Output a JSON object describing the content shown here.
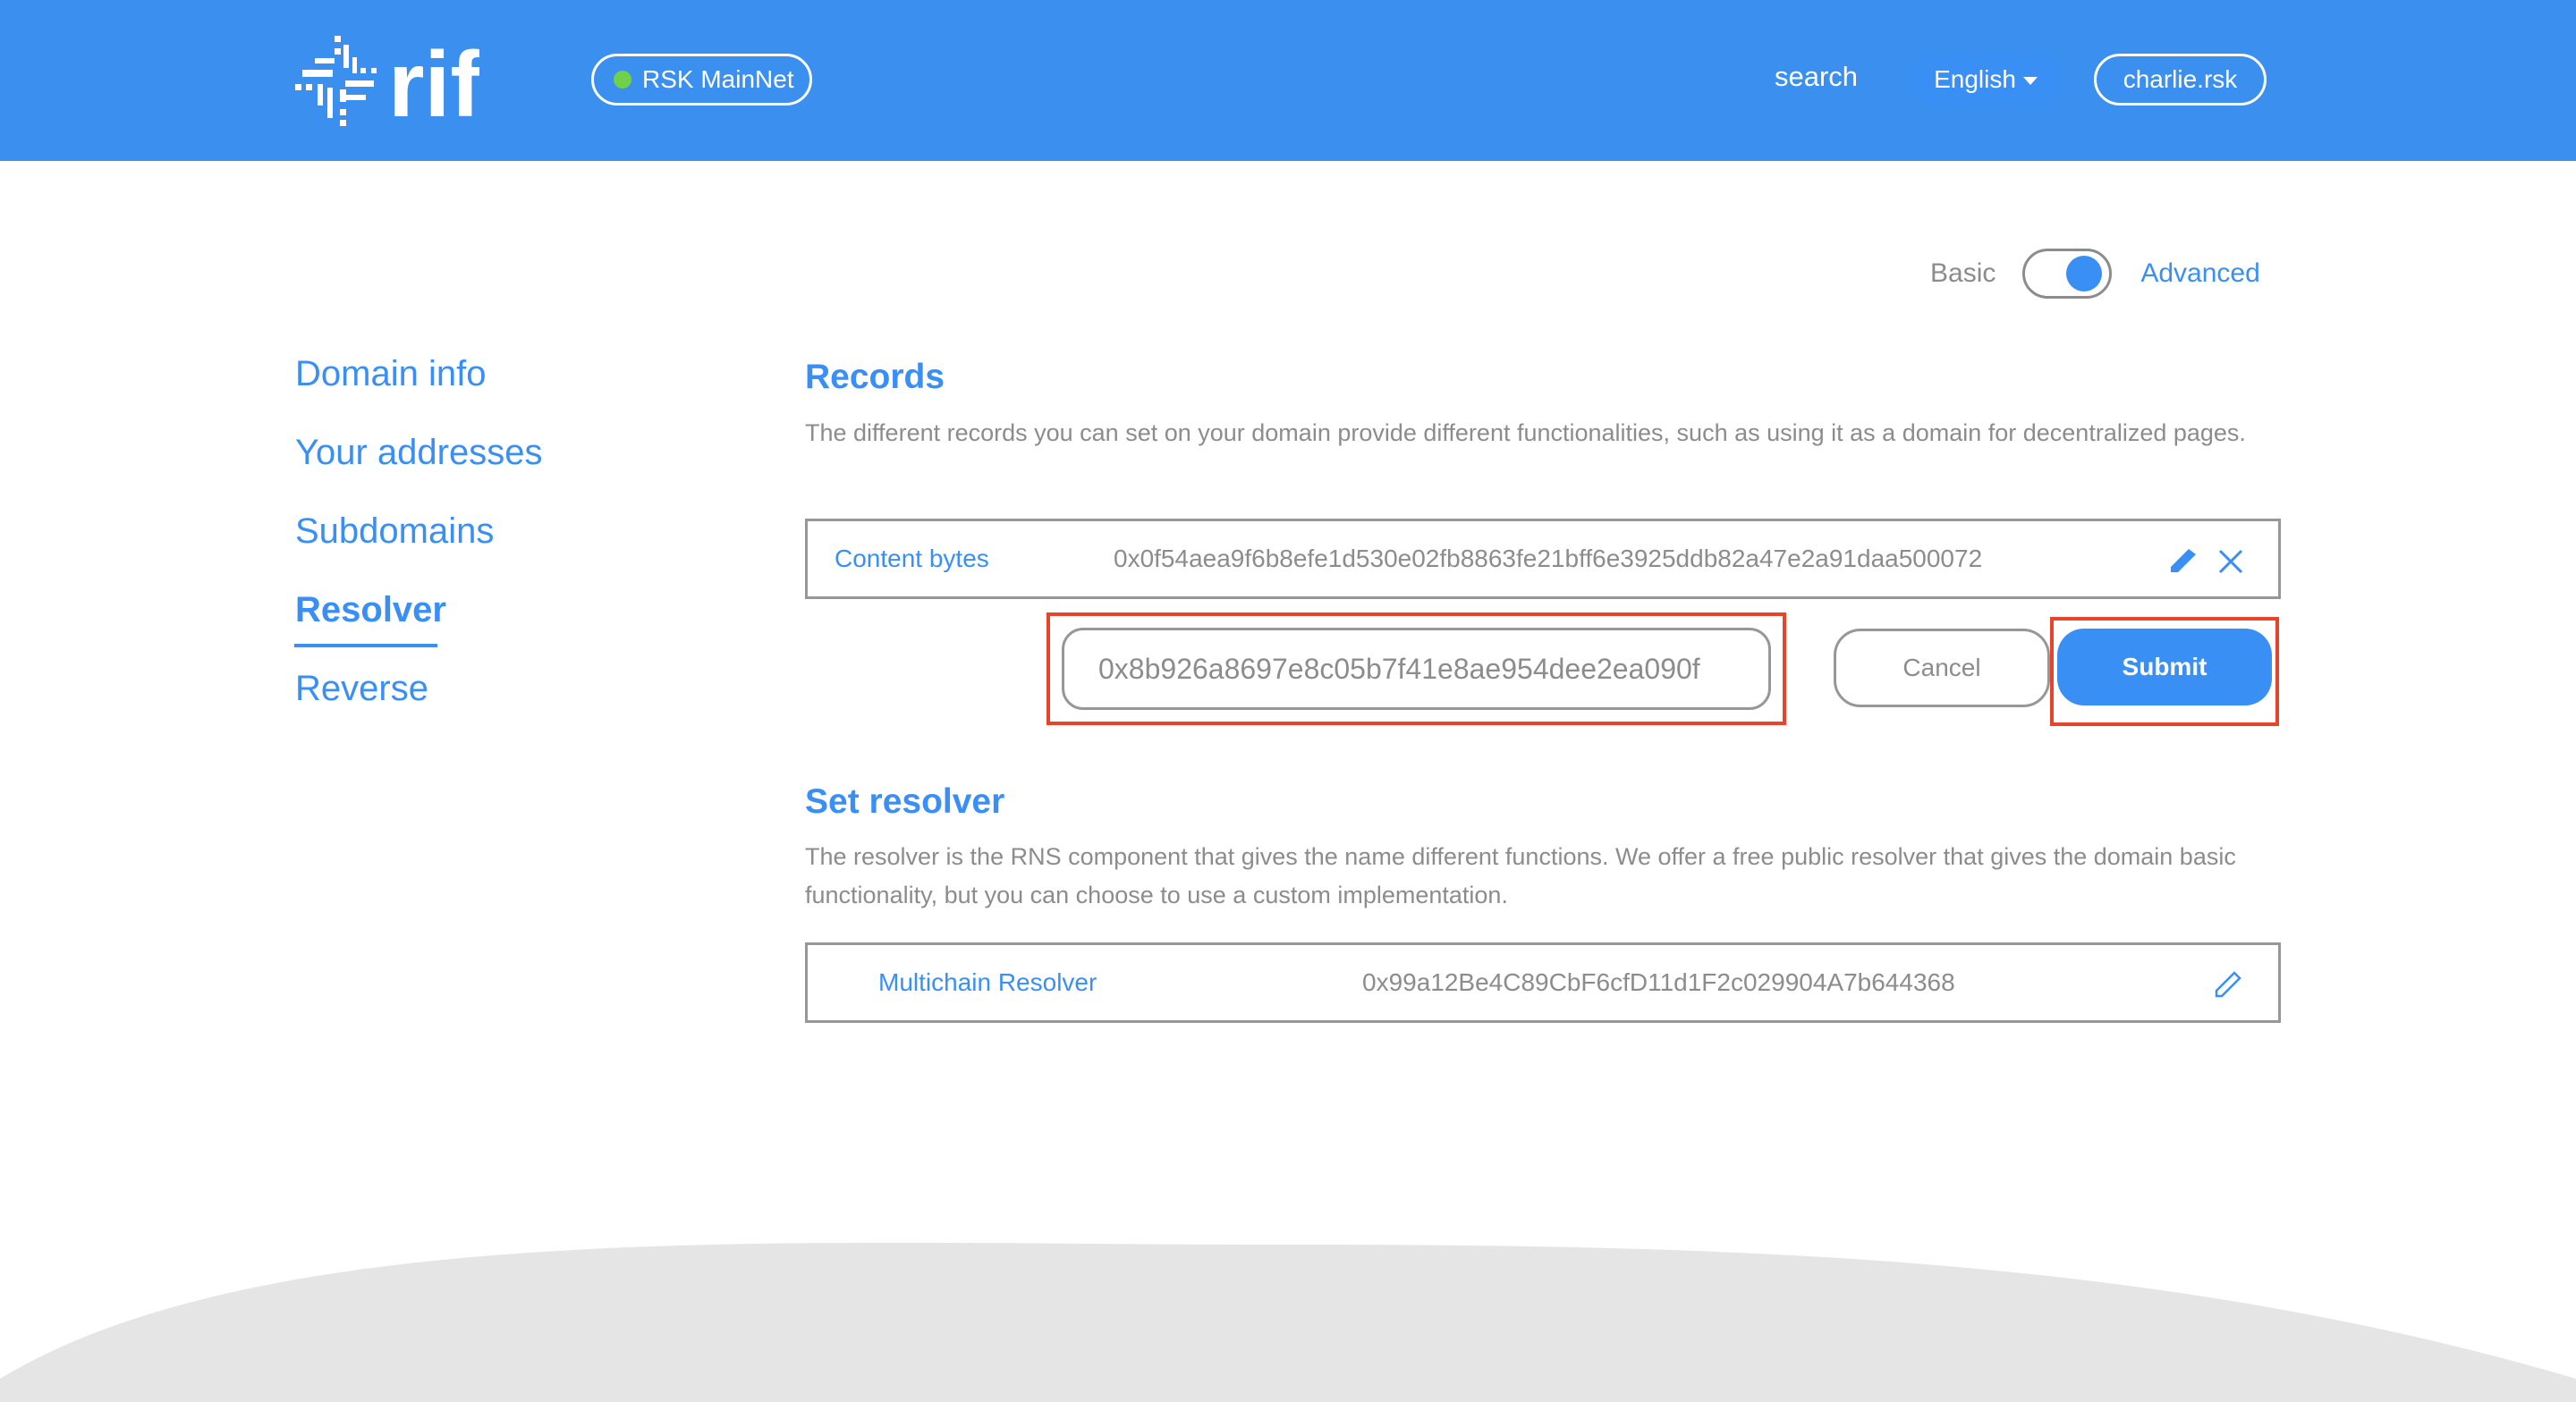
{
  "header": {
    "logo_text": "rif",
    "network": {
      "label": "RSK MainNet",
      "status_color": "#6fd147"
    },
    "search_label": "search",
    "language": {
      "selected": "English"
    },
    "account": "charlie.rsk",
    "brand_color": "#3a8fef"
  },
  "view_toggle": {
    "basic_label": "Basic",
    "advanced_label": "Advanced",
    "selected": "Advanced"
  },
  "sidebar": {
    "items": [
      {
        "label": "Domain info",
        "active": false
      },
      {
        "label": "Your addresses",
        "active": false
      },
      {
        "label": "Subdomains",
        "active": false
      },
      {
        "label": "Resolver",
        "active": true
      },
      {
        "label": "Reverse",
        "active": false
      }
    ]
  },
  "records": {
    "title": "Records",
    "description": "The different records you can set on your domain provide different functionalities, such as using it as a domain for decentralized pages.",
    "rows": [
      {
        "label": "Content bytes",
        "value": "0x0f54aea9f6b8efe1d530e02fb8863fe21bff6e3925ddb82a47e2a91daa500072"
      }
    ],
    "edit": {
      "input_value": "0x8b926a8697e8c05b7f41e8ae954dee2ea090f",
      "cancel_label": "Cancel",
      "submit_label": "Submit"
    }
  },
  "set_resolver": {
    "title": "Set resolver",
    "description": "The resolver is the RNS component that gives the name different functions. We offer a free public resolver that gives the domain basic functionality, but you can choose to use a custom implementation.",
    "resolver": {
      "label": "Multichain Resolver",
      "address": "0x99a12Be4C89CbF6cfD11d1F2c029904A7b644368"
    }
  },
  "colors": {
    "accent": "#3a8ff5",
    "muted_text": "#8c8c8c",
    "highlight": "#e8442c",
    "footer": "#e5e5e5"
  }
}
